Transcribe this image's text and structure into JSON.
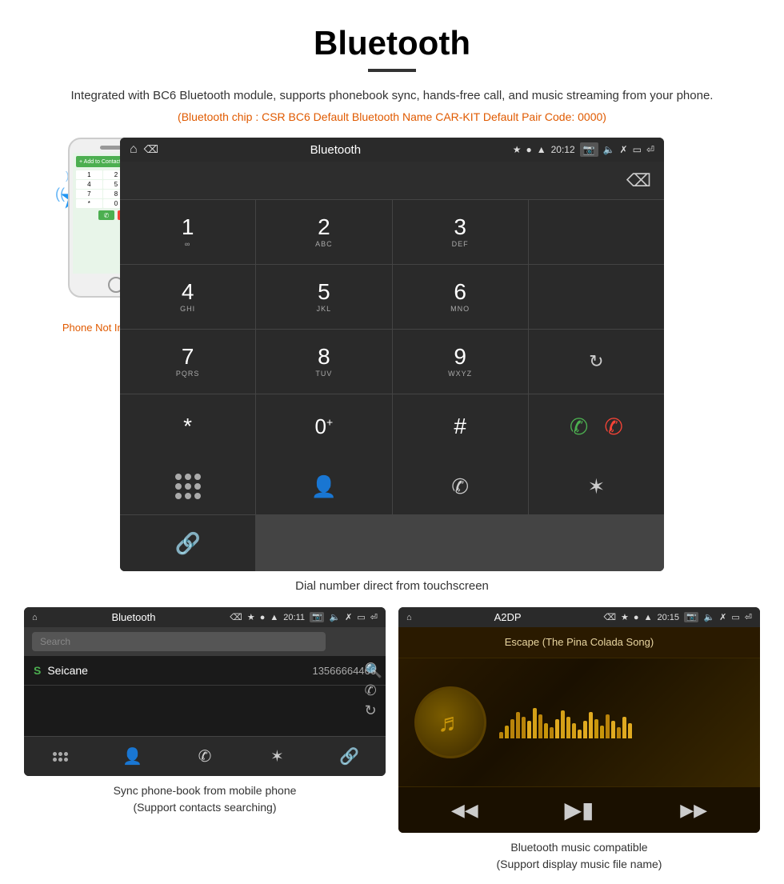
{
  "page": {
    "title": "Bluetooth",
    "subtitle": "Integrated with BC6 Bluetooth module, supports phonebook sync, hands-free call, and music streaming from your phone.",
    "specs": "(Bluetooth chip : CSR BC6    Default Bluetooth Name CAR-KIT    Default Pair Code: 0000)",
    "dial_caption": "Dial number direct from touchscreen",
    "phonebook_caption": "Sync phone-book from mobile phone\n(Support contacts searching)",
    "music_caption": "Bluetooth music compatible\n(Support display music file name)",
    "phone_not_included": "Phone Not Included"
  },
  "dial_screen": {
    "status_bar": {
      "app_name": "Bluetooth",
      "time": "20:12"
    },
    "keys": [
      {
        "num": "1",
        "sub": "∞"
      },
      {
        "num": "2",
        "sub": "ABC"
      },
      {
        "num": "3",
        "sub": "DEF"
      },
      {
        "num": "",
        "sub": ""
      },
      {
        "num": "4",
        "sub": "GHI"
      },
      {
        "num": "5",
        "sub": "JKL"
      },
      {
        "num": "6",
        "sub": "MNO"
      },
      {
        "num": "",
        "sub": ""
      },
      {
        "num": "7",
        "sub": "PQRS"
      },
      {
        "num": "8",
        "sub": "TUV"
      },
      {
        "num": "9",
        "sub": "WXYZ"
      },
      {
        "num": "",
        "sub": ""
      },
      {
        "num": "*",
        "sub": ""
      },
      {
        "num": "0",
        "sub": "+"
      },
      {
        "num": "#",
        "sub": ""
      }
    ]
  },
  "phonebook_screen": {
    "status_bar": {
      "app_name": "Bluetooth",
      "time": "20:11"
    },
    "search_placeholder": "Search",
    "contact": {
      "letter": "S",
      "name": "Seicane",
      "number": "13566664466"
    }
  },
  "music_screen": {
    "status_bar": {
      "app_name": "A2DP",
      "time": "20:15"
    },
    "song_title": "Escape (The Pina Colada Song)",
    "eq_bars": [
      3,
      6,
      9,
      12,
      10,
      8,
      14,
      11,
      7,
      5,
      9,
      13,
      10,
      7,
      4,
      8,
      12,
      9,
      6,
      11,
      8,
      5,
      10,
      7
    ]
  }
}
